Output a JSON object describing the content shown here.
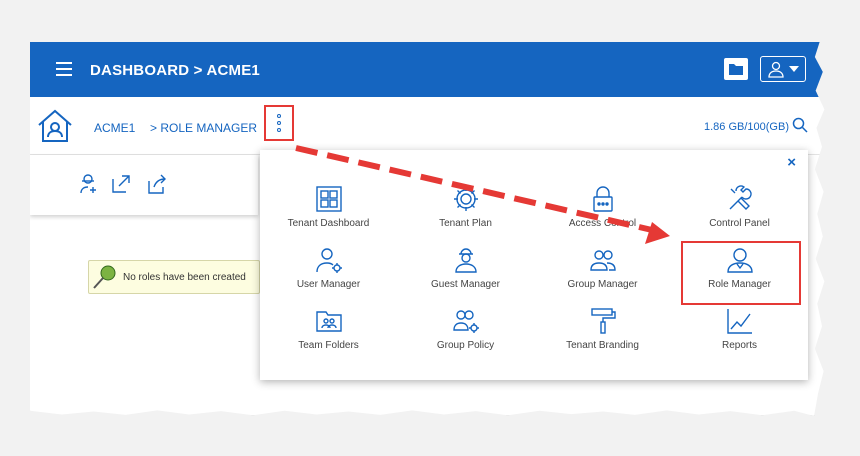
{
  "header": {
    "title": "DASHBOARD > ACME1"
  },
  "breadcrumb": {
    "tenant": "ACME1",
    "page": "> ROLE MANAGER"
  },
  "storage": {
    "usage": "1.86 GB/100(GB)"
  },
  "notice": {
    "text": "No roles have been created"
  },
  "menu": {
    "close_label": "×",
    "items": [
      {
        "label": "Tenant Dashboard",
        "icon": "grid-icon"
      },
      {
        "label": "Tenant Plan",
        "icon": "cog-icon"
      },
      {
        "label": "Access Control",
        "icon": "lock-icon"
      },
      {
        "label": "Control Panel",
        "icon": "tools-icon"
      },
      {
        "label": "User Manager",
        "icon": "user-cog-icon"
      },
      {
        "label": "Guest Manager",
        "icon": "guest-icon"
      },
      {
        "label": "Group Manager",
        "icon": "group-icon"
      },
      {
        "label": "Role Manager",
        "icon": "role-user-icon"
      },
      {
        "label": "Team Folders",
        "icon": "team-folder-icon"
      },
      {
        "label": "Group Policy",
        "icon": "group-policy-icon"
      },
      {
        "label": "Tenant Branding",
        "icon": "paint-roller-icon"
      },
      {
        "label": "Reports",
        "icon": "line-chart-icon"
      }
    ]
  },
  "colors": {
    "brand": "#1565c0",
    "highlight": "#e53935"
  }
}
